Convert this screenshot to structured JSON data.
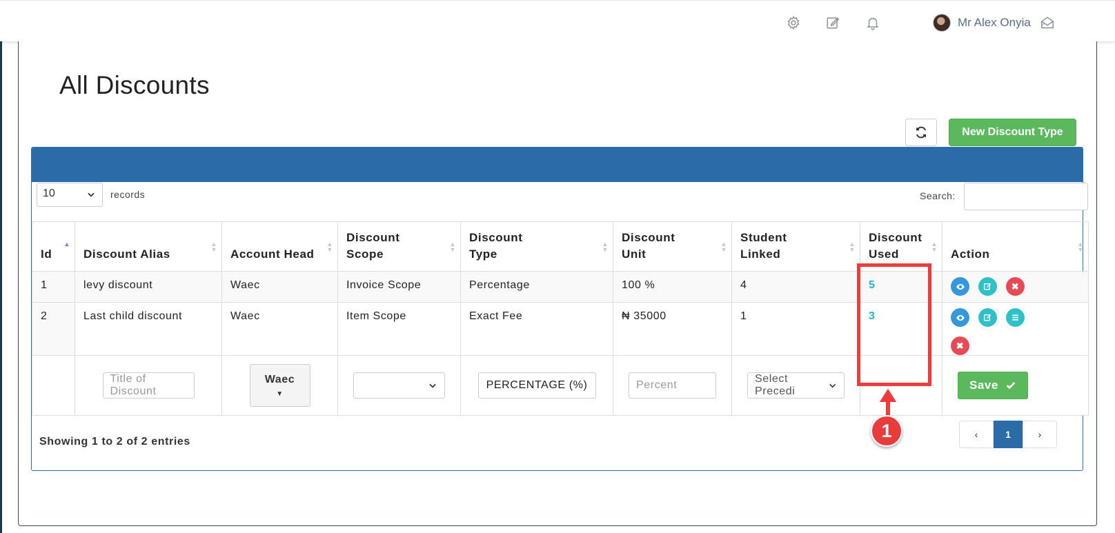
{
  "topbar": {
    "user_name": "Mr Alex Onyia"
  },
  "page": {
    "title": "All Discounts",
    "new_button_label": "New Discount Type"
  },
  "table_controls": {
    "page_size": "10",
    "records_label": "records",
    "search_label": "Search:"
  },
  "columns": [
    {
      "line1": "Id",
      "line2": ""
    },
    {
      "line1": "Discount Alias",
      "line2": ""
    },
    {
      "line1": "Account Head",
      "line2": ""
    },
    {
      "line1": "Discount",
      "line2": "Scope"
    },
    {
      "line1": "Discount",
      "line2": "Type"
    },
    {
      "line1": "Discount",
      "line2": "Unit"
    },
    {
      "line1": "Student",
      "line2": "Linked"
    },
    {
      "line1": "Discount",
      "line2": "Used"
    },
    {
      "line1": "Action",
      "line2": ""
    }
  ],
  "rows": [
    {
      "id": "1",
      "alias": "levy discount",
      "account_head": "Waec",
      "scope": "Invoice Scope",
      "type": "Percentage",
      "unit": "100 %",
      "linked": "4",
      "used": "5"
    },
    {
      "id": "2",
      "alias": "Last child discount",
      "account_head": "Waec",
      "scope": "Item Scope",
      "type": "Exact Fee",
      "unit": "₦ 35000",
      "linked": "1",
      "used": "3"
    }
  ],
  "form_row": {
    "title_placeholder": "Title of Discount",
    "account_head_value": "Waec",
    "type_button": "PERCENTAGE (%)",
    "unit_placeholder": "Percent",
    "precedence_placeholder": "Select Precedi",
    "save_label": "Save"
  },
  "footer": {
    "info": "Showing 1 to 2 of 2 entries",
    "current_page": "1"
  },
  "annotation": {
    "callout_number": "1",
    "color": "#ee3b3b"
  },
  "colors": {
    "primary": "#2b6ca8",
    "success": "#5cb85c",
    "info": "#2fc0c8",
    "danger": "#e64b55"
  }
}
